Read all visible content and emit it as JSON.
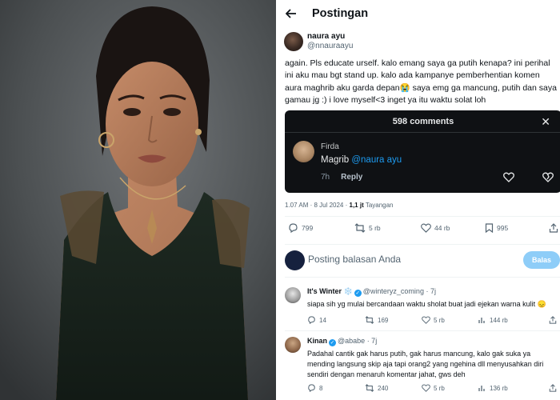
{
  "photo": {
    "alt": "portrait"
  },
  "header": {
    "title": "Postingan"
  },
  "tweet": {
    "display_name": "naura ayu",
    "handle": "@nnauraayu",
    "text": "again. Pls educate urself. kalo emang saya ga putih kenapa? ini perihal ini aku mau bgt stand up. kalo ada kampanye pemberhentian komen aura maghrib aku garda depan😭 saya emg ga mancung, putih dan saya gamau jg :) i love myself<3 inget ya itu waktu solat loh",
    "timestamp": "1.07 AM · 8 Jul 2024 · ",
    "views_count": "1,1 jt",
    "views_label": " Tayangan"
  },
  "embed": {
    "title": "598 comments",
    "commenter": "Firda",
    "comment_prefix": "Magrib ",
    "comment_mention": "@naura ayu",
    "age": "7h",
    "reply_label": "Reply"
  },
  "actions": {
    "replies": "799",
    "reposts": "5 rb",
    "likes": "44 rb",
    "views": "995"
  },
  "compose": {
    "placeholder": "Posting balasan Anda",
    "button": "Balas"
  },
  "replies": [
    {
      "name": "It's Winter ❄️",
      "handle": "@winteryz_coming",
      "age": " · 7j",
      "text": "siapa sih yg mulai bercandaan waktu sholat buat jadi ejekan warna kulit 😞",
      "comments": "14",
      "reposts": "169",
      "likes": "5 rb",
      "views": "144 rb"
    },
    {
      "name": "Kinan",
      "handle": "@ababe",
      "age": " · 7j",
      "text_lines": [
        "Padahal cantik gak harus putih, gak harus mancung, kalo gak suka ya",
        "mending langsung skip aja tapi orang2 yang ngehina dll menyusahkan diri",
        "sendiri dengan menaruh komentar jahat, gws deh"
      ],
      "comments": "8",
      "reposts": "240",
      "likes": "5 rb",
      "views": "136 rb"
    }
  ],
  "colors": {
    "accent": "#1d9bf0",
    "muted": "#536471",
    "embed_bg": "#0f1114"
  }
}
